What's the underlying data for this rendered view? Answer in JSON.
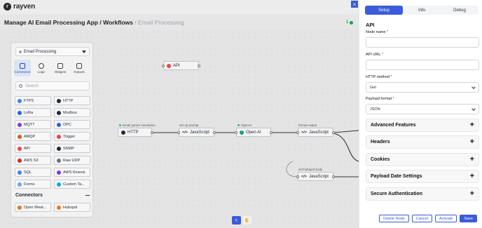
{
  "app": {
    "logo_text": "rayven",
    "logo_glyph": "r"
  },
  "breadcrumb": {
    "path": "Manage AI Email Processing App / Workflows",
    "current": "/ Email Processing",
    "counter": "1"
  },
  "palette": {
    "selected_workflow": "Email Processing",
    "tabs": [
      {
        "label": "Connectors"
      },
      {
        "label": "Logic"
      },
      {
        "label": "Widgets"
      },
      {
        "label": "Outputs"
      }
    ],
    "search_placeholder": "Search",
    "items": [
      {
        "label": "FTPS",
        "color": "#3b82f6"
      },
      {
        "label": "HTTP",
        "color": "#1f2937"
      },
      {
        "label": "LoRa",
        "color": "#2563eb"
      },
      {
        "label": "Modbus",
        "color": "#1f2937"
      },
      {
        "label": "MQTT",
        "color": "#7c3aed"
      },
      {
        "label": "OPC",
        "color": "#2563eb"
      },
      {
        "label": "AMQP",
        "color": "#ea580c"
      },
      {
        "label": "Trigger",
        "color": "#ef4444"
      },
      {
        "label": "API",
        "color": "#ef4444"
      },
      {
        "label": "SNMP",
        "color": "#1f2937"
      },
      {
        "label": "AWS S3",
        "color": "#dc2626"
      },
      {
        "label": "Raw UDP",
        "color": "#6b7280"
      },
      {
        "label": "SQL",
        "color": "#3b82f6"
      },
      {
        "label": "AWS Kinesis",
        "color": "#7c3aed"
      },
      {
        "label": "Forms",
        "color": "#60a5fa"
      },
      {
        "label": "Custom Ta...",
        "color": "#0ea5e9"
      }
    ],
    "section_title": "Connectors",
    "connectors": [
      {
        "label": "Open Weat...",
        "color": "#f97316"
      },
      {
        "label": "Hubspot",
        "color": "#f97316"
      }
    ]
  },
  "flow": {
    "nodes": [
      {
        "label": "API",
        "caption": ""
      },
      {
        "label": "HTTP",
        "caption": "Email parser simulation"
      },
      {
        "label": "JavaScript",
        "caption": "set up prompt"
      },
      {
        "label": "Open AI",
        "caption": "OpenAI"
      },
      {
        "label": "JavaScript",
        "caption": "format output"
      },
      {
        "label": "JavaScript",
        "caption": "set hubspot body"
      }
    ]
  },
  "panel": {
    "tabs": [
      "Setup",
      "Info",
      "Debug"
    ],
    "active_tab": "Setup",
    "section_title": "API",
    "fields": {
      "node_name_label": "Node name",
      "node_name_value": "",
      "api_url_label": "API URL",
      "api_url_value": "",
      "http_method_label": "HTTP method",
      "http_method_value": "Get",
      "payload_format_label": "Payload format",
      "payload_format_value": "JSON"
    },
    "accordions": [
      "Advanced Features",
      "Headers",
      "Cookies",
      "Payload Date Settings",
      "Secure Authentication"
    ],
    "buttons": {
      "delete": "Delete Node",
      "cancel": "Cancel",
      "activate": "Activate",
      "save": "Save"
    },
    "accent": "#3b5bdb"
  }
}
